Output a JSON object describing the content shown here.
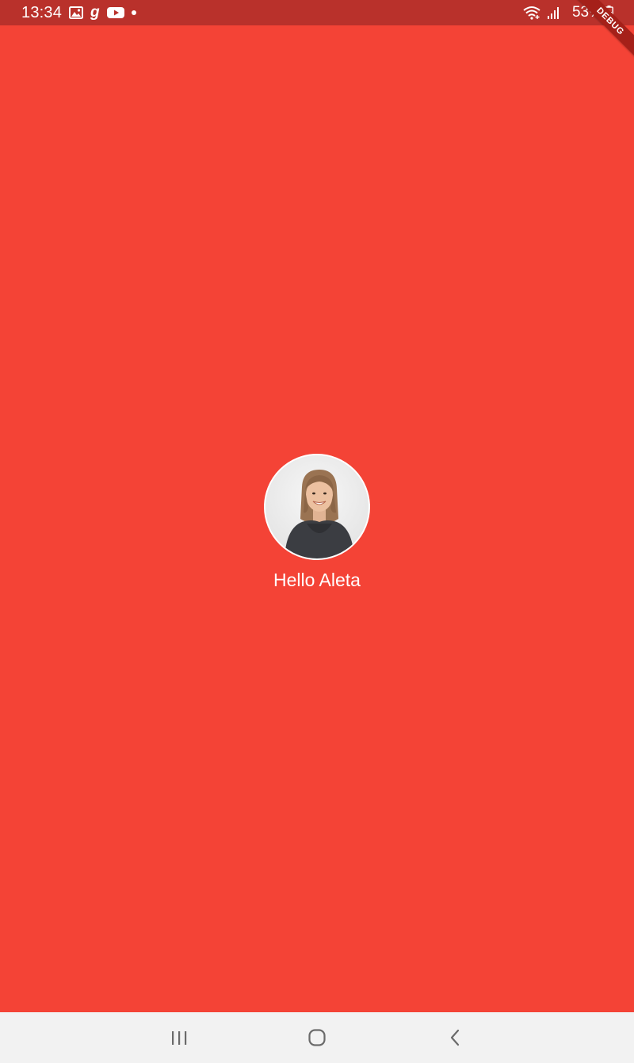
{
  "status_bar": {
    "time": "13:34",
    "battery": "53%",
    "left_icons": [
      "gallery-icon",
      "g-app-icon",
      "youtube-icon",
      "dot-icon"
    ],
    "right_icons": [
      "wifi-icon",
      "signal-icon",
      "battery-icon"
    ]
  },
  "debug_banner": {
    "label": "DEBUG"
  },
  "profile": {
    "greeting": "Hello Aleta"
  },
  "nav_bar": {
    "buttons": [
      "recent-apps-icon",
      "home-icon",
      "back-icon"
    ]
  },
  "colors": {
    "background": "#f44336",
    "status_bar": "#b9312b",
    "debug_ribbon": "#a52019",
    "nav_bar": "#f2f2f2",
    "text": "#ffffff"
  }
}
